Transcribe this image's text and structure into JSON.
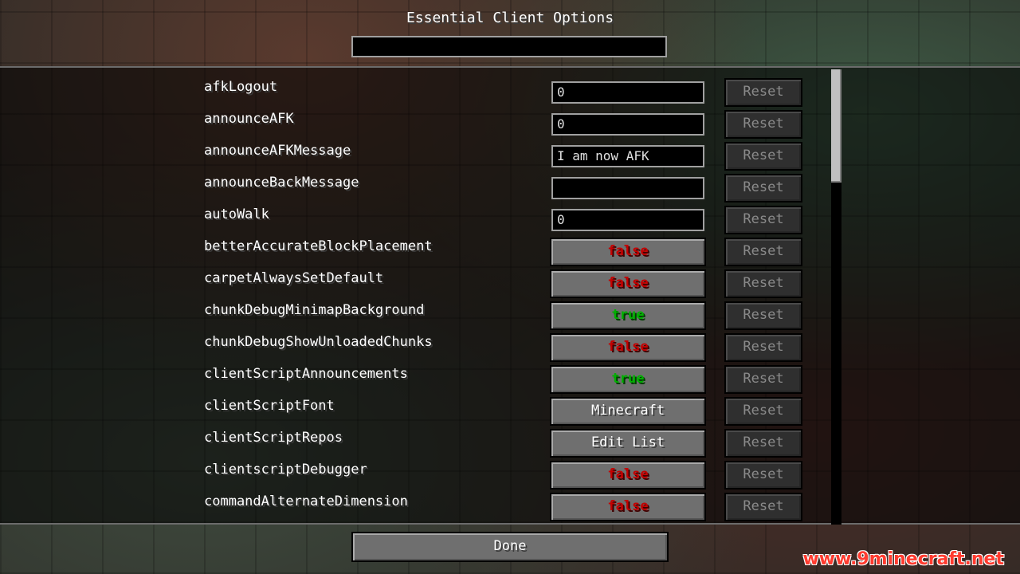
{
  "title": "Essential Client Options",
  "search": {
    "value": "",
    "placeholder": ""
  },
  "reset_label": "Reset",
  "options": [
    {
      "name": "afkLogout",
      "type": "text",
      "value": "0"
    },
    {
      "name": "announceAFK",
      "type": "text",
      "value": "0"
    },
    {
      "name": "announceAFKMessage",
      "type": "text",
      "value": "I am now AFK"
    },
    {
      "name": "announceBackMessage",
      "type": "text",
      "value": ""
    },
    {
      "name": "autoWalk",
      "type": "text",
      "value": "0"
    },
    {
      "name": "betterAccurateBlockPlacement",
      "type": "bool",
      "value": "false"
    },
    {
      "name": "carpetAlwaysSetDefault",
      "type": "bool",
      "value": "false"
    },
    {
      "name": "chunkDebugMinimapBackground",
      "type": "bool",
      "value": "true"
    },
    {
      "name": "chunkDebugShowUnloadedChunks",
      "type": "bool",
      "value": "false"
    },
    {
      "name": "clientScriptAnnouncements",
      "type": "bool",
      "value": "true"
    },
    {
      "name": "clientScriptFont",
      "type": "cycle",
      "value": "Minecraft"
    },
    {
      "name": "clientScriptRepos",
      "type": "list",
      "value": "Edit List"
    },
    {
      "name": "clientscriptDebugger",
      "type": "bool",
      "value": "false"
    },
    {
      "name": "commandAlternateDimension",
      "type": "bool",
      "value": "false"
    }
  ],
  "done_label": "Done",
  "watermark": "www.9minecraft.net",
  "colors": {
    "false": "#c40000",
    "true": "#00b000",
    "button": "#6f6f6f",
    "reset_disabled": "#2f2f2f"
  }
}
